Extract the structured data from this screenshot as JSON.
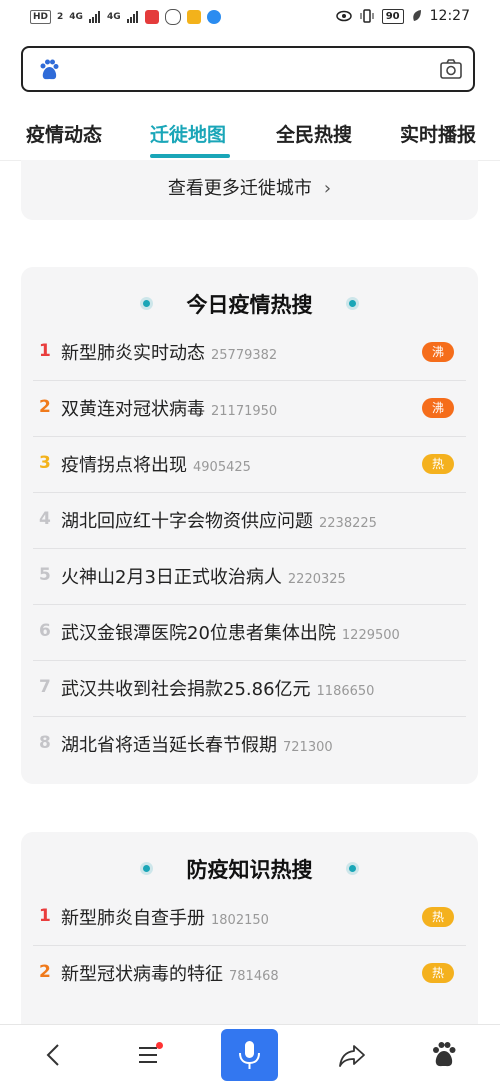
{
  "status": {
    "left_chip": "HD",
    "left_chip_sub": "2",
    "signal1": "4G",
    "signal2": "4G",
    "battery": "90",
    "time": "12:27"
  },
  "search": {
    "placeholder": "",
    "value": ""
  },
  "tabs": [
    {
      "label": "疫情动态",
      "active": false
    },
    {
      "label": "迁徙地图",
      "active": true
    },
    {
      "label": "全民热搜",
      "active": false
    },
    {
      "label": "实时播报",
      "active": false
    }
  ],
  "migration": {
    "more_link": "查看更多迁徙城市"
  },
  "today_hot": {
    "title": "今日疫情热搜",
    "items": [
      {
        "rank": "1",
        "title": "新型肺炎实时动态",
        "count": "25779382",
        "badge": "沸"
      },
      {
        "rank": "2",
        "title": "双黄连对冠状病毒",
        "count": "21171950",
        "badge": "沸"
      },
      {
        "rank": "3",
        "title": "疫情拐点将出现",
        "count": "4905425",
        "badge": "热"
      },
      {
        "rank": "4",
        "title": "湖北回应红十字会物资供应问题",
        "count": "2238225",
        "badge": ""
      },
      {
        "rank": "5",
        "title": "火神山2月3日正式收治病人",
        "count": "2220325",
        "badge": ""
      },
      {
        "rank": "6",
        "title": "武汉金银潭医院20位患者集体出院",
        "count": "1229500",
        "badge": ""
      },
      {
        "rank": "7",
        "title": "武汉共收到社会捐款25.86亿元",
        "count": "1186650",
        "badge": ""
      },
      {
        "rank": "8",
        "title": "湖北省将适当延长春节假期",
        "count": "721300",
        "badge": ""
      }
    ]
  },
  "prevention_hot": {
    "title": "防疫知识热搜",
    "items": [
      {
        "rank": "1",
        "title": "新型肺炎自查手册",
        "count": "1802150",
        "badge": "热"
      },
      {
        "rank": "2",
        "title": "新型冠状病毒的特征",
        "count": "781468",
        "badge": "热"
      }
    ]
  },
  "colors": {
    "accent": "#1aa6b8",
    "rank_red": "#e93d3d",
    "rank_orange": "#f07a1b",
    "rank_yellow": "#f3b21b",
    "badge_boil": "#f56d1b",
    "badge_hot": "#f4b11e",
    "mic": "#3377f0"
  },
  "icons": {
    "search_logo": "baidu-paw-icon",
    "camera": "camera-icon",
    "back": "back-arrow-icon",
    "menu": "menu-icon",
    "mic": "microphone-icon",
    "share": "share-icon",
    "home": "baidu-paw-icon"
  }
}
